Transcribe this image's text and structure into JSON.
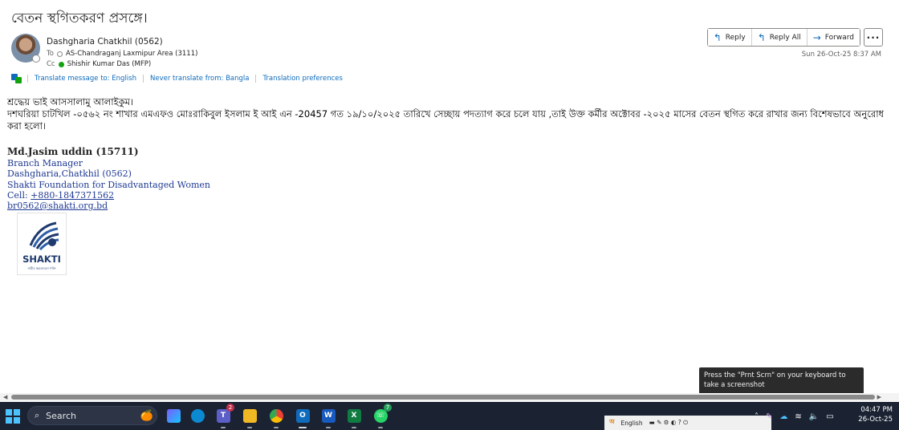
{
  "email": {
    "subject": "বেতন স্থগিতকরণ প্রসঙ্গে।",
    "sender": "Dashgharia Chatkhil (0562)",
    "to_label": "To",
    "to_value": "AS-Chandraganj Laxmipur Area (3111)",
    "cc_label": "Cc",
    "cc_value": "Shishir Kumar Das (MFP)",
    "date": "Sun 26-Oct-25 8:37 AM"
  },
  "actions": {
    "reply": "Reply",
    "reply_all": "Reply All",
    "forward": "Forward",
    "more": "···"
  },
  "translate": {
    "translate_msg": "Translate message to: English",
    "never_translate": "Never translate from: Bangla",
    "preferences": "Translation preferences"
  },
  "body": {
    "greeting": "শ্রদ্ধেয় ভাই আসসালামু আলাইকুম।",
    "paragraph": "দশঘরিয়া চাটখিল -০৫৬২ নং শাখার এমএফও মোঃরাকিবুল ইসলাম ই আই এন -20457 গত ১৯/১০/২০২৫ তারিখে সেচ্ছায় পদত্যাগ করে চলে যায় ,তাই উক্ত কর্মীর অক্টোবর -২০২৫ মাসের বেতন স্থগিত করে রাখার জন্য বিশেষভাবে অনুরোধ করা হলো।"
  },
  "signature": {
    "name": "Md.Jasim uddin (15711)",
    "title": "Branch Manager",
    "branch": "Dashgharia,Chatkhil (0562)",
    "org": "Shakti Foundation for Disadvantaged Women",
    "cell_label": "Cell: ",
    "cell": "+880-1847371562",
    "email": "br0562@shakti.org.bd",
    "logo_text": "SHAKTI",
    "logo_tagline": "নারীর ক্ষমতায়নে শক্তি"
  },
  "tooltip": "Press the \"Prnt Scrn\" on your keyboard to take a screenshot",
  "taskbar": {
    "search": "Search",
    "teams_badge": "2",
    "whatsapp_badge": "7",
    "language": "English",
    "time": "04:47 PM",
    "date": "26-Oct-25"
  },
  "colors": {
    "accent": "#0f6cbd",
    "presence_online": "#13a10e",
    "taskbar": "#1b2333",
    "signature": "#1f3a93"
  }
}
